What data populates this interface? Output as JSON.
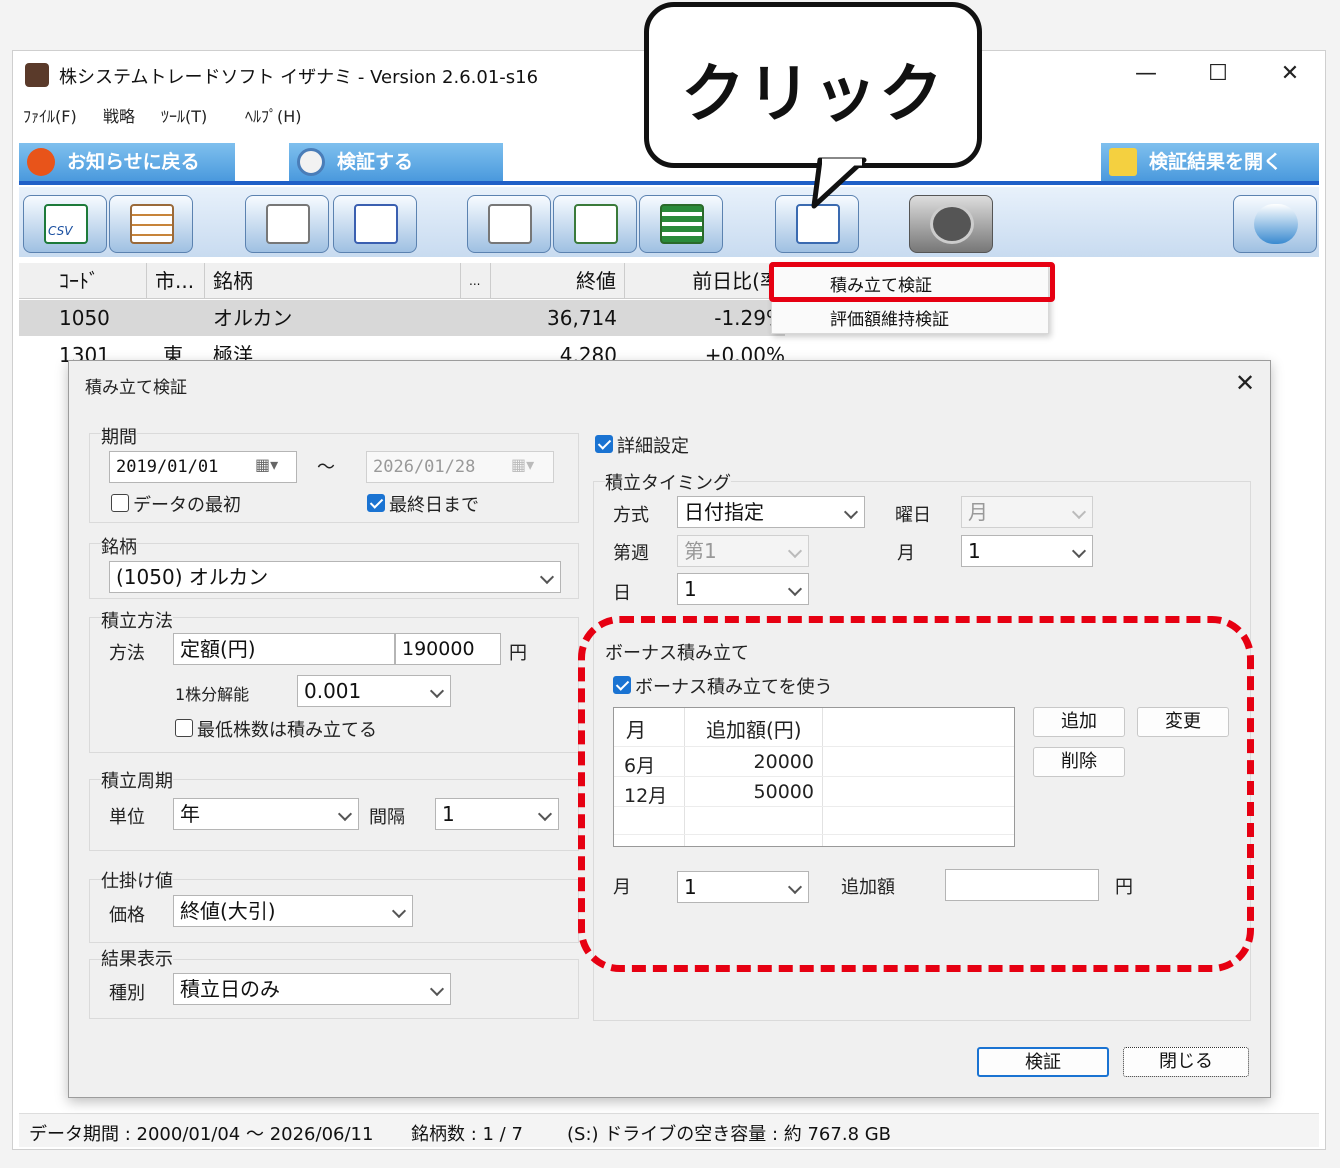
{
  "window": {
    "title": "株システムトレードソフト イザナミ - Version 2.6.01-s16",
    "minimize": "—",
    "maximize": "☐",
    "close": "✕"
  },
  "menu": [
    "ﾌｧｲﾙ(F)",
    "戦略",
    "ﾂｰﾙ(T)",
    "ﾍﾙﾌﾟ(H)"
  ],
  "tabs": {
    "news": "お知らせに戻る",
    "verify": "検証する",
    "open_results": "検証結果を開く"
  },
  "toolbar": {
    "csv": "CSV"
  },
  "callout": {
    "text": "クリック"
  },
  "grid": {
    "headers": [
      "ｺｰﾄﾞ",
      "市...",
      "銘柄",
      "...",
      "終値",
      "前日比(率"
    ],
    "rows": [
      [
        "1050",
        "",
        "オルカン",
        "",
        "36,714",
        "-1.29%"
      ],
      [
        "1301",
        "東",
        "極洋",
        "",
        "4,280",
        "+0.00%"
      ]
    ]
  },
  "context_menu": {
    "items": [
      "積み立て検証",
      "評価額維持検証"
    ]
  },
  "dialog": {
    "title": "積み立て検証",
    "period": {
      "label": "期間",
      "start": "2019/01/01",
      "tilde": "〜",
      "end": "2026/01/28",
      "from_beginning": "データの最初",
      "to_last": "最終日まで"
    },
    "stock": {
      "label": "銘柄",
      "value": "(1050) オルカン"
    },
    "method": {
      "label": "積立方法",
      "method_label": "方法",
      "method_value": "定額(円)",
      "amount": "190000",
      "yen": "円",
      "resolution_label": "1株分解能",
      "resolution_value": "0.001",
      "min_shares": "最低株数は積み立てる"
    },
    "cycle": {
      "label": "積立周期",
      "unit_label": "単位",
      "unit_value": "年",
      "interval_label": "間隔",
      "interval_value": "1"
    },
    "price": {
      "label": "仕掛け値",
      "price_label": "価格",
      "price_value": "終値(大引)"
    },
    "result": {
      "label": "結果表示",
      "kind_label": "種別",
      "kind_value": "積立日のみ"
    },
    "detail": {
      "checkbox": "詳細設定",
      "timing_label": "積立タイミング",
      "mode_label": "方式",
      "mode_value": "日付指定",
      "weekday_label": "曜日",
      "weekday_value": "月",
      "week_label": "第週",
      "week_value": "第1",
      "month_label": "月",
      "month_value": "1",
      "day_label": "日",
      "day_value": "1"
    },
    "bonus": {
      "label": "ボーナス積み立て",
      "checkbox": "ボーナス積み立てを使う",
      "col_month": "月",
      "col_amount": "追加額(円)",
      "rows": [
        {
          "month": "6月",
          "amount": "20000"
        },
        {
          "month": "12月",
          "amount": "50000"
        }
      ],
      "add": "追加",
      "change": "変更",
      "delete": "削除",
      "month_label": "月",
      "month_value": "1",
      "amount_label": "追加額",
      "amount_value": "",
      "yen": "円"
    },
    "buttons": {
      "verify": "検証",
      "close": "閉じる"
    }
  },
  "status": {
    "period": "データ期間 : 2000/01/04 〜 2026/06/11",
    "count": "銘柄数 : 1 / 7",
    "drive": "(S:) ドライブの空き容量 : 約 767.8 GB"
  }
}
